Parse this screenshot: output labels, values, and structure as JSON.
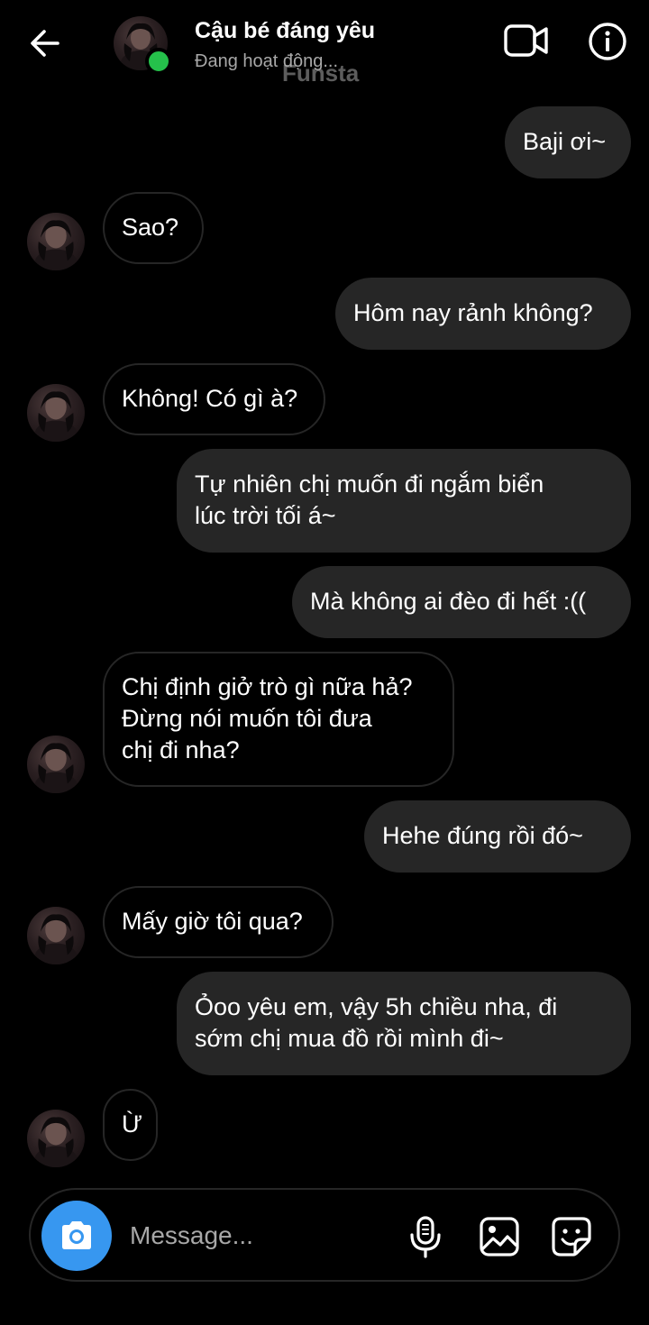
{
  "header": {
    "contact_name": "Cậu bé đáng yêu",
    "status": "Đang hoạt động...",
    "watermark": "Funsta",
    "icons": {
      "back": "arrow-left-icon",
      "video": "video-camera-icon",
      "info": "info-icon"
    },
    "online_color": "#25C14B"
  },
  "messages": [
    {
      "side": "out",
      "text": "Baji ơi~"
    },
    {
      "side": "in",
      "text": "Sao?"
    },
    {
      "side": "out",
      "text": "Hôm nay rảnh không?"
    },
    {
      "side": "in",
      "text": "Không! Có gì à?"
    },
    {
      "side": "out",
      "text": "Tự nhiên chị muốn đi ngắm biển\nlúc trời tối á~"
    },
    {
      "side": "out",
      "text": "Mà không ai đèo đi hết :(("
    },
    {
      "side": "in",
      "text": "Chị định giở trò gì nữa hả?\nĐừng nói muốn tôi đưa\nchị đi nha?"
    },
    {
      "side": "out",
      "text": "Hehe đúng rồi đó~"
    },
    {
      "side": "in",
      "text": "Mấy giờ tôi qua?"
    },
    {
      "side": "out",
      "text": "Ỏoo yêu em, vậy 5h chiều nha, đi\nsớm chị mua đồ rồi mình đi~"
    },
    {
      "side": "in",
      "text": "Ừ"
    }
  ],
  "composer": {
    "placeholder": "Message...",
    "icons": {
      "camera": "camera-icon",
      "mic": "microphone-icon",
      "gallery": "image-icon",
      "sticker": "sticker-icon"
    },
    "camera_color": "#3797F0"
  },
  "colors": {
    "background": "#000000",
    "outgoing_bubble": "#262626",
    "incoming_border": "#262626",
    "secondary_text": "#A8A8A8"
  }
}
